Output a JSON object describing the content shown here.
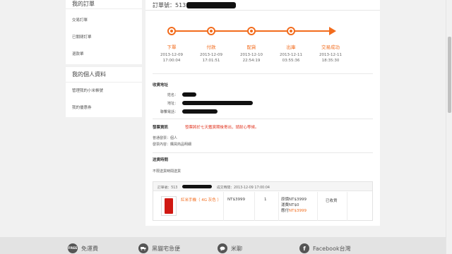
{
  "sidebar": {
    "orders_heading": "我的訂單",
    "order_items": [
      "交易訂單",
      "已關閉訂單",
      "退款單"
    ],
    "profile_heading": "我的個人資料",
    "profile_items": [
      "管理我的小米帳號",
      "我的優惠券"
    ]
  },
  "order": {
    "title": "訂單號：513"
  },
  "timeline": {
    "steps": [
      {
        "name": "下單",
        "date": "2013-12-09",
        "time": "17:00:04"
      },
      {
        "name": "付款",
        "date": "2013-12-09",
        "time": "17:01:51"
      },
      {
        "name": "配貨",
        "date": "2013-12-10",
        "time": "22:54:19"
      },
      {
        "name": "出庫",
        "date": "2013-12-11",
        "time": "03:55:36"
      },
      {
        "name": "交易成功",
        "date": "2013-12-11",
        "time": "18:35:30"
      }
    ],
    "accent": "#f26c1d"
  },
  "address": {
    "heading": "收貨地址",
    "name_label": "姓名：",
    "addr_label": "地址：",
    "phone_label": "聯繫電話："
  },
  "invoice": {
    "heading": "發票資訊",
    "notice": "發票將於七天鑑賞期後寄出，請耐心等候。",
    "type_label": "普通發票：",
    "type_value": "個人",
    "content_label": "發票內容：",
    "content_value": "購買商品明細"
  },
  "delivery": {
    "heading": "送貨時間",
    "value": "不限送貨時間送貨"
  },
  "order_box": {
    "order_no_label": "訂單號：513",
    "deal_time": "成交時間：2013-12-09 17:00:04",
    "product_name": "紅米手機（ 4G 灰色 ）",
    "unit_price": "NT$3999",
    "quantity": "1",
    "original_price_label": "原價",
    "original_price": "NT$3999",
    "shipping_label": "運費",
    "shipping": "NT$0",
    "paid_label": "應付",
    "paid": "NT$3999",
    "status": "已收貨"
  },
  "footer": {
    "items": [
      {
        "icon": "free-shipping-icon",
        "badge": "FREE",
        "label": "免運費"
      },
      {
        "icon": "truck-icon",
        "badge": "",
        "label": "黑貓宅急便"
      },
      {
        "icon": "chat-icon",
        "badge": "",
        "label": "米聊"
      },
      {
        "icon": "facebook-icon",
        "badge": "f",
        "label": "Facebook台灣"
      }
    ]
  }
}
